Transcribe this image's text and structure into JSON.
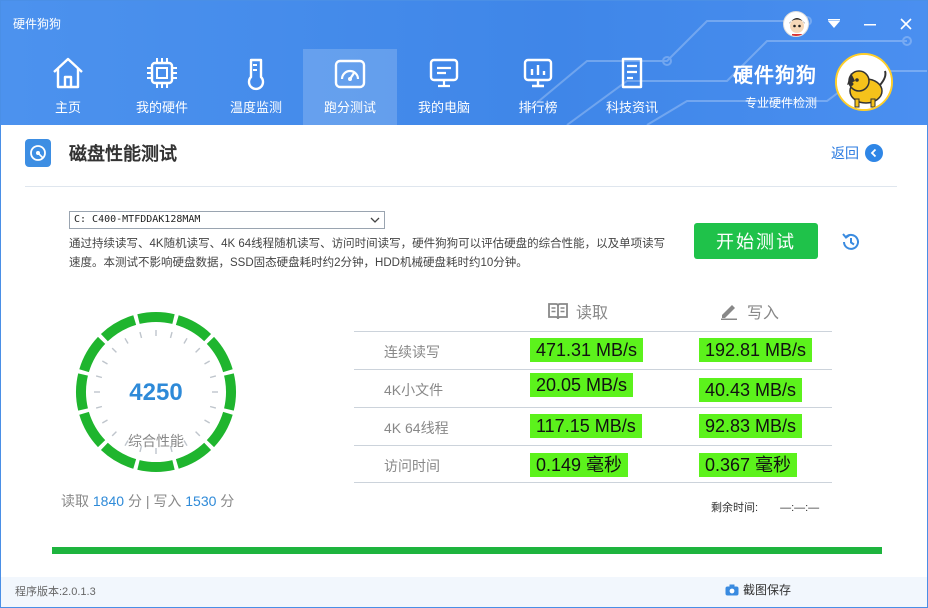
{
  "window": {
    "title": "硬件狗狗"
  },
  "nav": [
    {
      "label": "主页",
      "icon": "home-icon"
    },
    {
      "label": "我的硬件",
      "icon": "chip-icon"
    },
    {
      "label": "温度监测",
      "icon": "thermometer-icon"
    },
    {
      "label": "跑分测试",
      "icon": "speedometer-icon",
      "active": true
    },
    {
      "label": "我的电脑",
      "icon": "monitor-icon"
    },
    {
      "label": "排行榜",
      "icon": "ranking-icon"
    },
    {
      "label": "科技资讯",
      "icon": "news-icon"
    }
  ],
  "brand": {
    "name": "硬件狗狗",
    "sub": "专业硬件检测"
  },
  "section": {
    "title": "磁盘性能测试",
    "back_label": "返回"
  },
  "drive": {
    "selected": "C: C400-MTFDDAK128MAM"
  },
  "description": "通过持续读写、4K随机读写、4K 64线程随机读写、访问时间读写，硬件狗狗可以评估硬盘的综合性能，以及单项读写速度。本测试不影响硬盘数据，SSD固态硬盘耗时约2分钟，HDD机械硬盘耗时约10分钟。",
  "start_button": "开始测试",
  "score": {
    "total": "4250",
    "label": "综合性能",
    "read_label": "读取",
    "read": "1840",
    "write_label": "写入",
    "write": "1530",
    "unit": "分",
    "sep": "|"
  },
  "table": {
    "read_header": "读取",
    "write_header": "写入",
    "rows": [
      {
        "label": "连续读写",
        "read": "471.31 MB/s",
        "write": "192.81 MB/s"
      },
      {
        "label": "4K小文件",
        "read": "20.05 MB/s",
        "write": "40.43 MB/s"
      },
      {
        "label": "4K 64线程",
        "read": "117.15 MB/s",
        "write": "92.83 MB/s"
      },
      {
        "label": "访问时间",
        "read": "0.149 毫秒",
        "write": "0.367 毫秒"
      }
    ]
  },
  "remaining": {
    "label": "剩余时间:",
    "value": "—:—:—"
  },
  "progress": {
    "percent": 100,
    "color": "#1eb43e"
  },
  "footer": {
    "version": "程序版本:2.0.1.3",
    "screenshot": "截图保存"
  },
  "colors": {
    "accent": "#3f86e8",
    "highlight": "#5cf21c",
    "start": "#1fc24a"
  }
}
